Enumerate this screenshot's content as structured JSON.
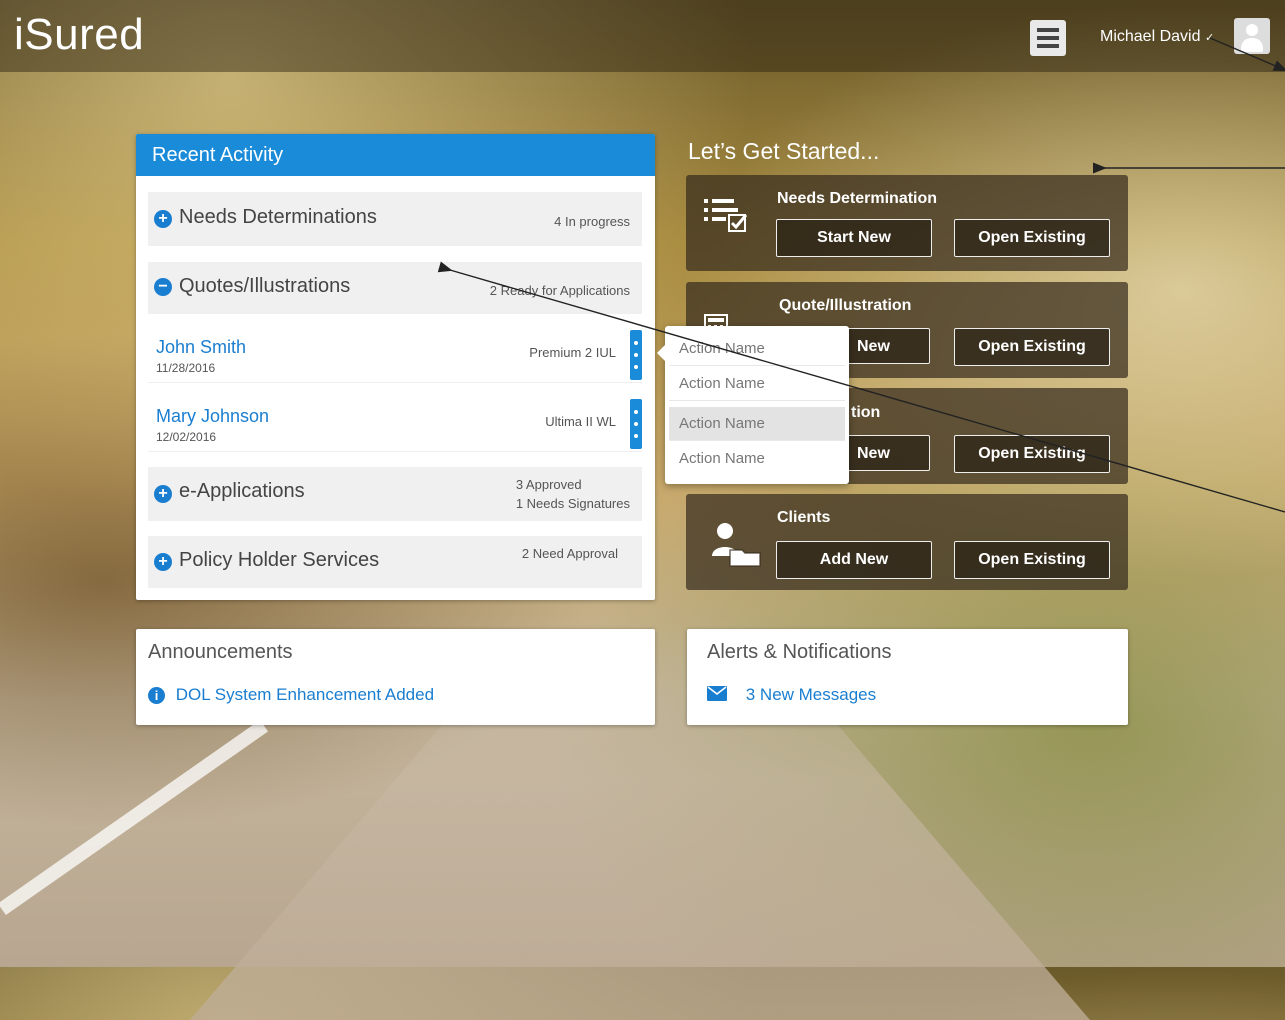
{
  "header": {
    "logo": "iSured",
    "user_name": "Michael David",
    "user_chevron": "✓"
  },
  "recent_activity": {
    "title": "Recent Activity",
    "rows": [
      {
        "label": "Needs Determinations",
        "status_lines": [
          "4 In progress"
        ],
        "expanded": false
      },
      {
        "label": "Quotes/Illustrations",
        "status_lines": [
          "2 Ready for Applications"
        ],
        "expanded": true
      },
      {
        "label": "e-Applications",
        "status_lines": [
          "3 Approved",
          "1 Needs Signatures"
        ],
        "expanded": false
      },
      {
        "label": "Policy Holder Services",
        "status_lines": [
          "2 Need Approval"
        ],
        "expanded": false
      }
    ],
    "quote_items": [
      {
        "name": "John Smith",
        "date": "11/28/2016",
        "product": "Premium 2 IUL"
      },
      {
        "name": "Mary Johnson",
        "date": "12/02/2016",
        "product": "Ultima II WL"
      }
    ]
  },
  "dropdown": {
    "items": [
      "Action Name",
      "Action Name",
      "Action Name",
      "Action Name"
    ],
    "selected_index": 2
  },
  "get_started": {
    "title": "Let’s Get Started...",
    "cards": [
      {
        "title": "Needs Determination",
        "icon": "checklist-icon",
        "buttons": [
          "Start New",
          "Open Existing"
        ]
      },
      {
        "title": "Quote/Illustration",
        "icon": "calculator-icon",
        "buttons": [
          "New",
          "Open Existing"
        ]
      },
      {
        "title": "tion",
        "icon": "document-icon",
        "buttons": [
          "New",
          "Open Existing"
        ]
      },
      {
        "title": "Clients",
        "icon": "clients-folder-icon",
        "buttons": [
          "Add New",
          "Open Existing"
        ]
      }
    ]
  },
  "announcements": {
    "title": "Announcements",
    "link": "DOL System Enhancement Added",
    "icon": "info-icon"
  },
  "alerts": {
    "title": "Alerts & Notifications",
    "link": "3 New Messages",
    "icon": "envelope-icon"
  },
  "colors": {
    "accent": "#1a8bd8",
    "link": "#1a7ed0"
  }
}
